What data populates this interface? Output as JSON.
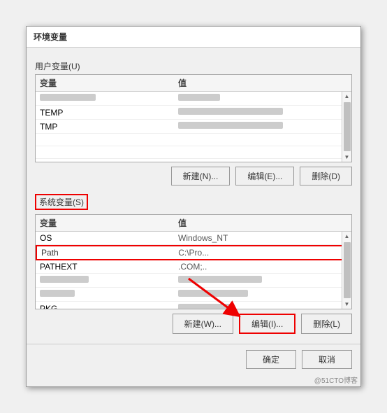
{
  "dialog": {
    "title": "环境变量",
    "user_section_label": "用户变量(U)",
    "system_section_label": "系统变量(S)",
    "col_name": "变量",
    "col_value": "值",
    "user_vars": [
      {
        "name": "",
        "value": "",
        "blurred": true,
        "width_name": 80,
        "width_value": 180
      },
      {
        "name": "TEMP",
        "value": "",
        "blurred_value": true,
        "width_value": 200
      },
      {
        "name": "TMP",
        "value": "",
        "blurred_value": true,
        "width_value": 200
      }
    ],
    "sys_vars": [
      {
        "name": "OS",
        "value": "Windows_NT"
      },
      {
        "name": "Path",
        "value": "C:\\Pro...",
        "highlighted": true
      },
      {
        "name": "PATHEXT",
        "value": ".COM;.."
      },
      {
        "name": "",
        "value": "",
        "blurred": true
      },
      {
        "name": "",
        "value": "",
        "blurred": true
      },
      {
        "name": "PKG",
        "value": "",
        "blurred": true
      }
    ],
    "buttons": {
      "new_user": "新建(N)...",
      "edit_user": "编辑(E)...",
      "delete_user": "删除(D)",
      "new_sys": "新建(W)...",
      "edit_sys": "编辑(I)...",
      "delete_sys": "删除(L)",
      "ok": "确定",
      "cancel": "取消"
    },
    "watermark": "@51CTO博客"
  }
}
